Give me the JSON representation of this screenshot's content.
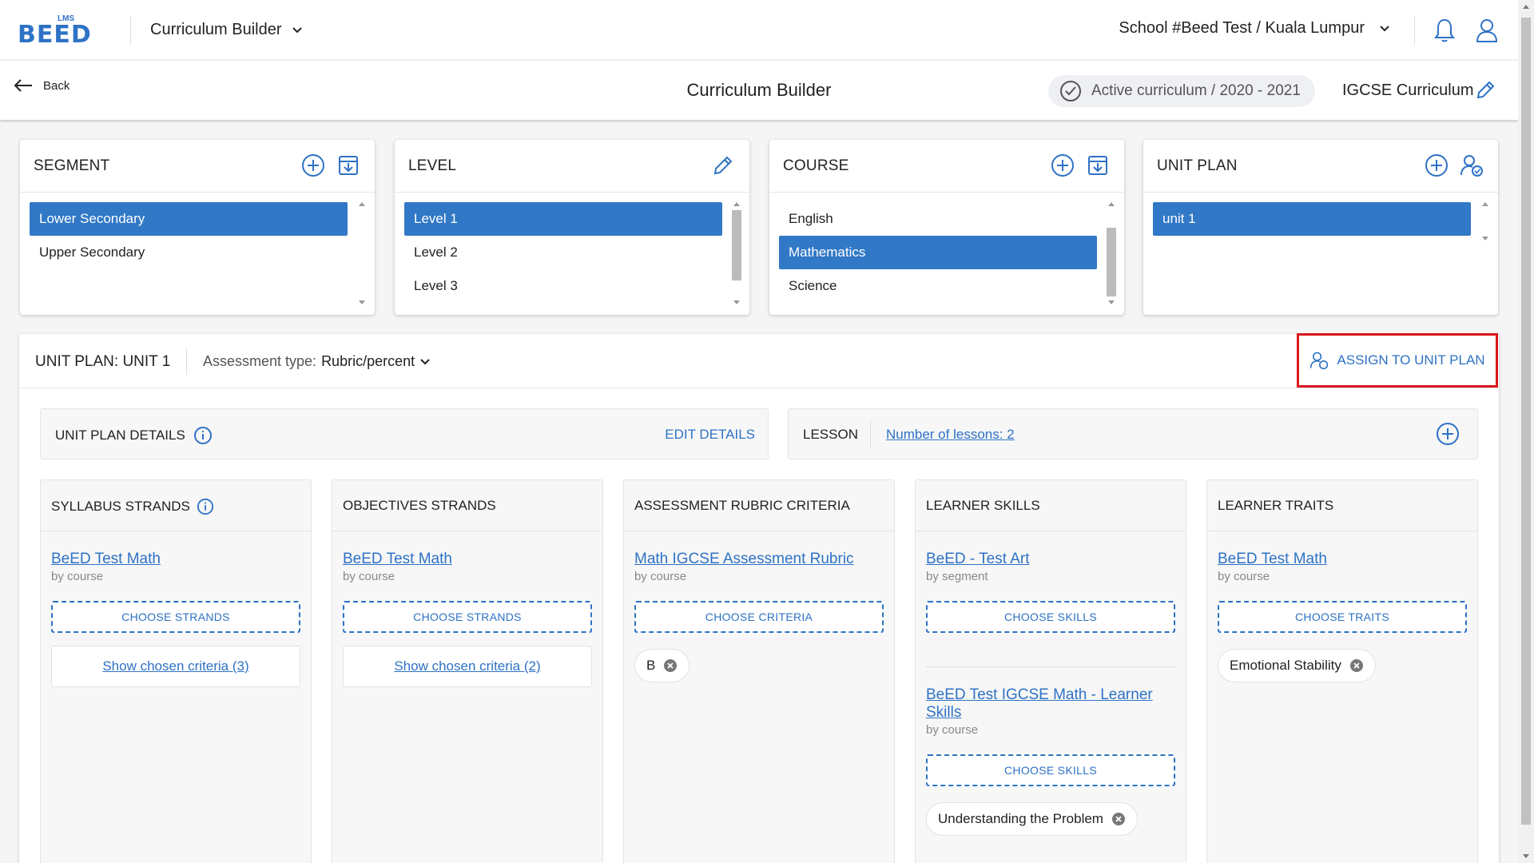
{
  "topbar": {
    "logo_small": "LMS",
    "logo_word": "BEED",
    "app_switch_label": "Curriculum Builder",
    "school_label": "School #Beed Test / Kuala Lumpur"
  },
  "subbar": {
    "back_label": "Back",
    "page_title": "Curriculum Builder",
    "active_curriculum": "Active curriculum / 2020 - 2021",
    "curriculum_name": "IGCSE Curriculum"
  },
  "panels": {
    "segment": {
      "title": "SEGMENT",
      "items": [
        "Lower Secondary",
        "Upper Secondary"
      ],
      "selected": "Lower Secondary"
    },
    "level": {
      "title": "LEVEL",
      "items": [
        "Level 1",
        "Level 2",
        "Level 3"
      ],
      "selected": "Level 1"
    },
    "course": {
      "title": "COURSE",
      "items": [
        "English",
        "Mathematics",
        "Science"
      ],
      "selected": "Mathematics"
    },
    "unit_plan": {
      "title": "UNIT PLAN",
      "items": [
        "unit 1"
      ],
      "selected": "unit 1"
    }
  },
  "unit": {
    "title": "UNIT PLAN: UNIT 1",
    "assessment_label": "Assessment type:",
    "assessment_value": "Rubric/percent",
    "assign_label": "ASSIGN TO UNIT PLAN",
    "details_label": "UNIT PLAN DETAILS",
    "edit_details": "EDIT DETAILS",
    "lesson_label": "LESSON",
    "lesson_count": "Number of lessons: 2"
  },
  "columns": {
    "syllabus": {
      "title": "SYLLABUS STRANDS",
      "source": "BeED Test Math",
      "source_sub": "by course",
      "choose": "CHOOSE STRANDS",
      "show": "Show chosen criteria (3)"
    },
    "objectives": {
      "title": "OBJECTIVES STRANDS",
      "source": "BeED Test Math",
      "source_sub": "by course",
      "choose": "CHOOSE STRANDS",
      "show": "Show chosen criteria (2)"
    },
    "rubric": {
      "title": "ASSESSMENT RUBRIC CRITERIA",
      "source": "Math IGCSE Assessment Rubric",
      "source_sub": "by course",
      "choose": "CHOOSE CRITERIA",
      "chip": "B"
    },
    "skills": {
      "title": "LEARNER SKILLS",
      "source": "BeED - Test Art",
      "source_sub": "by segment",
      "choose": "CHOOSE SKILLS",
      "source2": "BeED Test IGCSE Math - Learner Skills",
      "source2_sub": "by course",
      "choose2": "CHOOSE SKILLS",
      "chip": "Understanding the Problem"
    },
    "traits": {
      "title": "LEARNER TRAITS",
      "source": "BeED Test Math",
      "source_sub": "by course",
      "choose": "CHOOSE TRAITS",
      "chip": "Emotional Stability"
    }
  },
  "colors": {
    "accent": "#2e72c5",
    "selected": "#3178c6",
    "highlight": "#d9171e"
  }
}
